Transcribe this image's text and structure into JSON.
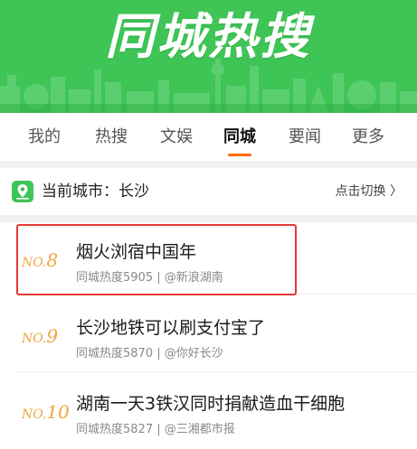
{
  "banner": {
    "title": "同城热搜"
  },
  "tabs": [
    {
      "label": "我的",
      "active": false
    },
    {
      "label": "热搜",
      "active": false
    },
    {
      "label": "文娱",
      "active": false
    },
    {
      "label": "同城",
      "active": true
    },
    {
      "label": "要闻",
      "active": false
    },
    {
      "label": "更多",
      "active": false
    }
  ],
  "city": {
    "icon": "location-map-icon",
    "current": "当前城市：长沙",
    "switch_label": "点击切换 〉"
  },
  "items": [
    {
      "rank_prefix": "NO.",
      "rank_num": "8",
      "title": "烟火浏宿中国年",
      "meta": "同城热度5905 | @新浪湖南",
      "highlighted": true
    },
    {
      "rank_prefix": "NO.",
      "rank_num": "9",
      "title": "长沙地铁可以刷支付宝了",
      "meta": "同城热度5870 | @你好长沙",
      "highlighted": false
    },
    {
      "rank_prefix": "NO.",
      "rank_num": "10",
      "title": "湖南一天3铁汉同时捐献造血干细胞",
      "meta": "同城热度5827 | @三湘都市报",
      "highlighted": false
    }
  ],
  "colors": {
    "brand_green": "#3fc456",
    "tab_accent": "#ff6a00",
    "rank_orange": "#f0a640",
    "highlight_red": "#e53935"
  }
}
